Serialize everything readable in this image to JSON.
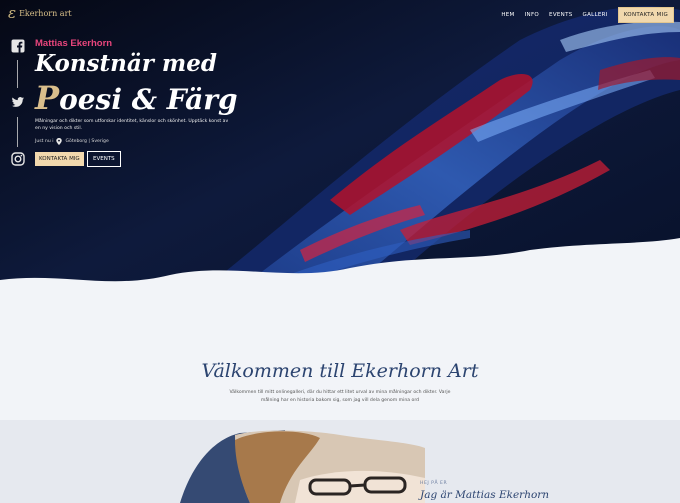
{
  "nav": {
    "logo_text": "Ekerhorn art",
    "items": [
      "HEM",
      "INFO",
      "EVENTS",
      "GALLERI"
    ],
    "cta_label": "KONTAKTA MIG"
  },
  "social": {
    "icons": [
      "facebook-icon",
      "twitter-icon",
      "instagram-icon"
    ]
  },
  "hero": {
    "name": "Mattias Ekerhorn",
    "title_line1": "Konstnär med",
    "title_accent": "P",
    "title_rest": "oesi & Färg",
    "description": "Målningar och dikter som utforskar identitet, känslor och skönhet. Upptäck konst av en ny vision och stil.",
    "location_prefix": "Just nu i",
    "location": "Göteborg | Sverige",
    "btn_contact": "KONTAKTA MIG",
    "btn_events": "EVENTS"
  },
  "welcome": {
    "heading": "Välkommen till Ekerhorn Art",
    "text": "Välkommen till mitt onlinegalleri, där du hittar ett litet urval av mina målningar och dikter. Varje målning har en historia bakom sig, som jag vill dela genom mina ord"
  },
  "about": {
    "eyebrow": "HEJ PÅ ER",
    "heading": "Jag är Mattias Ekerhorn"
  },
  "colors": {
    "accent_gold": "#f1d8ad",
    "name_pink": "#e8457c",
    "heading_navy": "#2c4470"
  }
}
